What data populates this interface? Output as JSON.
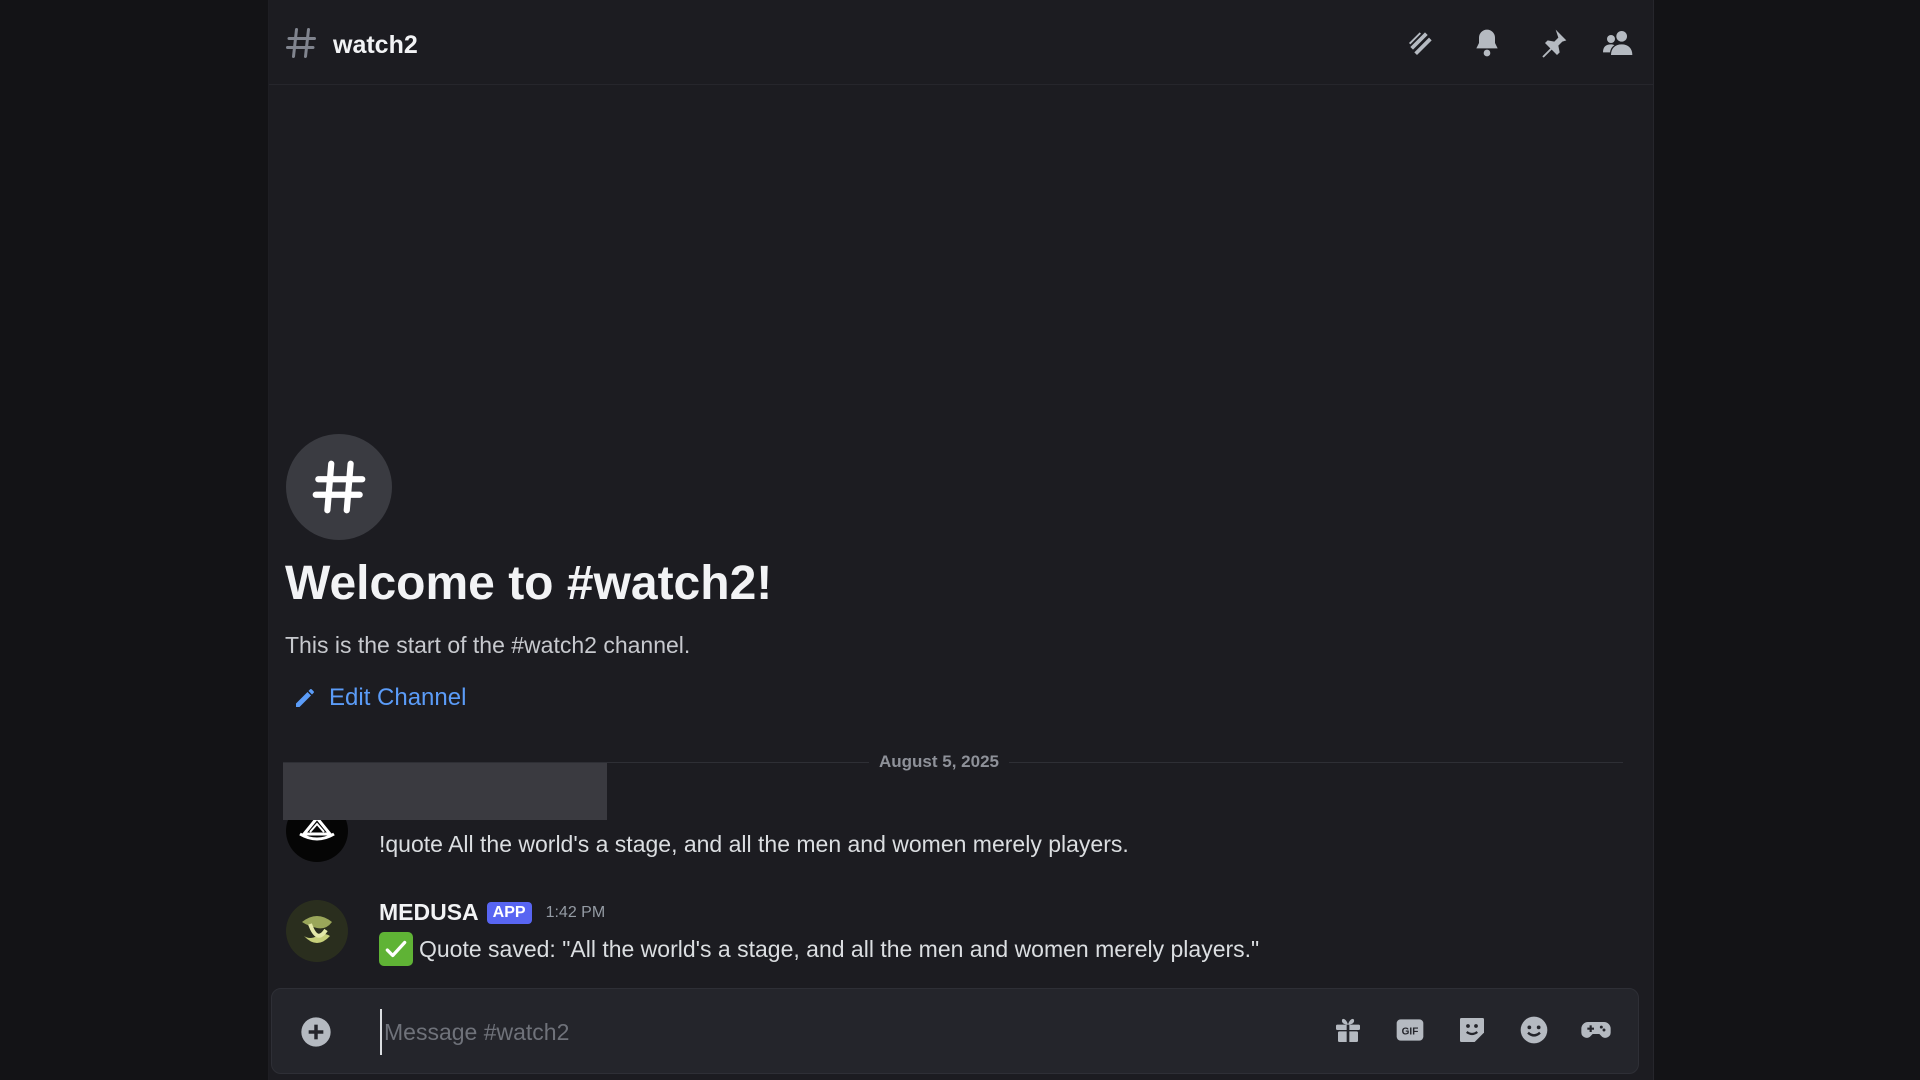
{
  "channel": {
    "name": "watch2"
  },
  "header": {
    "icons": [
      "threads-icon",
      "bell-icon",
      "pin-icon",
      "members-icon"
    ]
  },
  "welcome": {
    "title": "Welcome to #watch2!",
    "subtitle": "This is the start of the #watch2 channel.",
    "edit_label": "Edit Channel"
  },
  "divider": {
    "date": "August 5, 2025"
  },
  "messages": [
    {
      "author": "",
      "text": "!quote All the world's a stage, and all the men and women merely players."
    },
    {
      "author": "MEDUSA",
      "badge": "APP",
      "timestamp": "1:42 PM",
      "text": "Quote saved: \"All the world's a stage, and all the men and women merely players.\""
    }
  ],
  "composer": {
    "placeholder": "Message #watch2",
    "value": "",
    "icons": [
      "gift-icon",
      "gif-icon",
      "sticker-icon",
      "emoji-icon",
      "apps-icon"
    ]
  },
  "colors": {
    "background": "#1c1c21",
    "link": "#5b9cf8",
    "app_badge": "#5865f2",
    "check": "#5fb335"
  }
}
